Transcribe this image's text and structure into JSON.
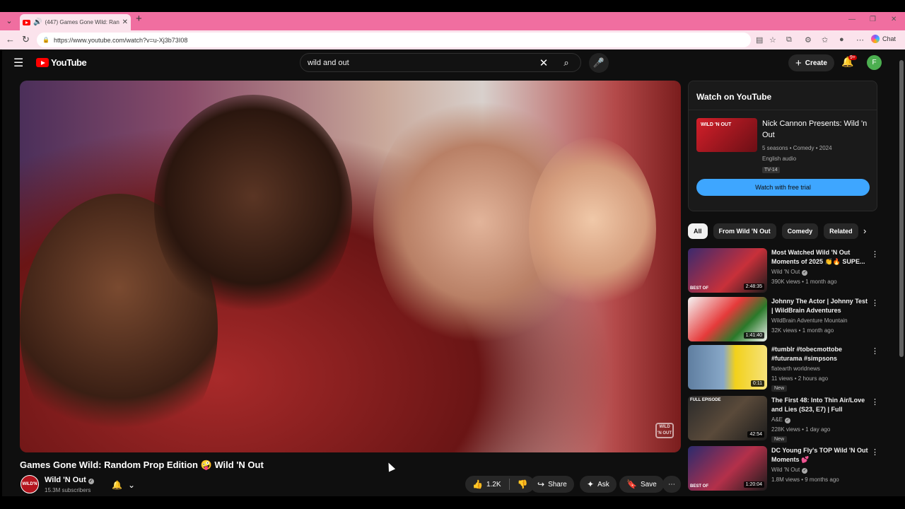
{
  "browser": {
    "tab_title": "(447) Games Gone Wild: Rand",
    "url": "https://www.youtube.com/watch?v=u-Xj3b73I08",
    "chat_label": "Chat"
  },
  "header": {
    "logo_text": "YouTube",
    "search_value": "wild and out",
    "create_label": "Create",
    "notification_badge": "9+",
    "avatar_letter": "F"
  },
  "video": {
    "title": "Games Gone Wild: Random Prop Edition 🤪 Wild 'N Out",
    "watermark": "WILD 'N OUT",
    "channel_name": "Wild 'N Out",
    "channel_avatar_text": "WILD'N OUT",
    "subscribers": "15.3M subscribers",
    "likes": "1.2K",
    "share_label": "Share",
    "ask_label": "Ask",
    "save_label": "Save"
  },
  "watch_card": {
    "header": "Watch on YouTube",
    "poster_text": "WILD 'N OUT",
    "show_title": "Nick Cannon Presents: Wild 'n Out",
    "meta1": "5 seasons • Comedy • 2024",
    "meta2": "English audio",
    "rating": "TV-14",
    "button": "Watch with free trial"
  },
  "chips": [
    "All",
    "From Wild 'N Out",
    "Comedy",
    "Related"
  ],
  "recommendations": [
    {
      "title": "Most Watched Wild 'N Out Moments of 2025 👏🔥 SUPE...",
      "channel": "Wild 'N Out",
      "verified": true,
      "views": "390K views • 1 month ago",
      "duration": "2:48:35",
      "tag": "BEST OF",
      "new": ""
    },
    {
      "title": "Johnny The Actor | Johnny Test | WildBrain Adventures",
      "channel": "WildBrain Adventure Mountain",
      "verified": false,
      "views": "32K views • 1 month ago",
      "duration": "1:41:40",
      "tag": "",
      "new": ""
    },
    {
      "title": "#tumblr #tobecmottobe #futurama #simpsons",
      "channel": "flatearth worldnews",
      "verified": false,
      "views": "11 views • 2 hours ago",
      "duration": "0:11",
      "tag": "",
      "new": "New"
    },
    {
      "title": "The First 48: Into Thin Air/Love and Lies (S23, E7) | Full Episode",
      "channel": "A&E",
      "verified": true,
      "views": "228K views • 1 day ago",
      "duration": "42:54",
      "tag": "FULL EPISODE",
      "new": "New"
    },
    {
      "title": "DC Young Fly's TOP Wild 'N Out Moments 💕",
      "channel": "Wild 'N Out",
      "verified": true,
      "views": "1.8M views • 9 months ago",
      "duration": "1:20:04",
      "tag": "BEST OF",
      "new": ""
    }
  ],
  "colors": {
    "accent": "#3ea6ff",
    "brand": "#ff0000",
    "background": "#0f0f0f",
    "tabbar": "#f06ea0"
  }
}
